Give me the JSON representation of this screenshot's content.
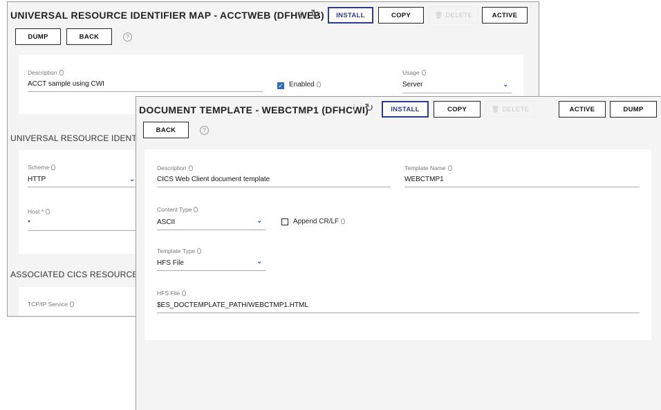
{
  "urimap": {
    "title": "UNIVERSAL RESOURCE IDENTIFIER MAP - ACCTWEB (DFHWEB)",
    "buttons": {
      "install": "INSTALL",
      "copy": "COPY",
      "delete": "DELETE",
      "active": "ACTIVE",
      "dump": "DUMP",
      "back": "BACK"
    },
    "description_label": "Description",
    "description_value": "ACCT sample using CWI",
    "enabled_label": "Enabled",
    "enabled_checked": true,
    "usage_label": "Usage",
    "usage_value": "Server",
    "section_uri": "UNIVERSAL RESOURCE IDENTIFIER",
    "scheme_label": "Scheme",
    "scheme_value": "HTTP",
    "host_label": "Host *",
    "host_value": "*",
    "section_assoc": "ASSOCIATED CICS RESOURCES",
    "tcpip_label": "TCP/IP Service"
  },
  "doctemplate": {
    "title": "DOCUMENT TEMPLATE - WEBCTMP1 (DFHCWI)",
    "buttons": {
      "install": "INSTALL",
      "copy": "COPY",
      "delete": "DELETE",
      "active": "ACTIVE",
      "dump": "DUMP",
      "back": "BACK"
    },
    "description_label": "Description",
    "description_value": "CICS Web Client document template",
    "template_name_label": "Template Name",
    "template_name_value": "WEBCTMP1",
    "content_type_label": "Content Type",
    "content_type_value": "ASCII",
    "append_label": "Append CR/LF",
    "append_checked": false,
    "template_type_label": "Template Type",
    "template_type_value": "HFS File",
    "hfs_label": "HFS File",
    "hfs_value": "$ES_DOCTEMPLATE_PATH/WEBCTMP1.HTML"
  },
  "icons": {
    "refresh": "refresh-icon",
    "help": "help-icon",
    "hint": "lightbulb-icon",
    "dropdown": "chevron-down-icon",
    "trash": "trash-icon"
  },
  "colors": {
    "accent": "#2b6db6",
    "primary_border": "#2b3a8c",
    "disabled": "#c8c8c8"
  }
}
